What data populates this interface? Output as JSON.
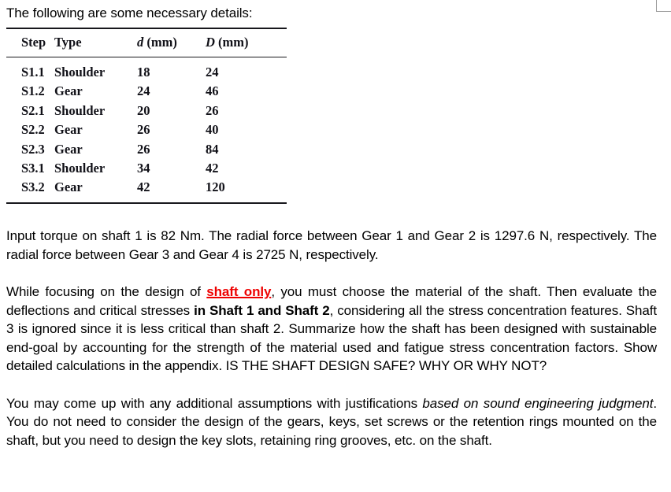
{
  "document": {
    "intro_line": "The following are some necessary details:",
    "corner_mark": "crop-mark"
  },
  "spec_table": {
    "columns": [
      {
        "key": "step",
        "label": "Step",
        "italic_symbol": "",
        "unit": ""
      },
      {
        "key": "type",
        "label": "Type",
        "italic_symbol": "",
        "unit": ""
      },
      {
        "key": "d",
        "label": "d (mm)",
        "italic_symbol": "d",
        "unit": "(mm)"
      },
      {
        "key": "D",
        "label": "D (mm)",
        "italic_symbol": "D",
        "unit": "(mm)"
      }
    ],
    "rows": [
      {
        "step": "S1.1",
        "type": "Shoulder",
        "d": "18",
        "D": "24"
      },
      {
        "step": "S1.2",
        "type": "Gear",
        "d": "24",
        "D": "46"
      },
      {
        "step": "S2.1",
        "type": "Shoulder",
        "d": "20",
        "D": "26"
      },
      {
        "step": "S2.2",
        "type": "Gear",
        "d": "26",
        "D": "40"
      },
      {
        "step": "S2.3",
        "type": "Gear",
        "d": "26",
        "D": "84"
      },
      {
        "step": "S3.1",
        "type": "Shoulder",
        "d": "34",
        "D": "42"
      },
      {
        "step": "S3.2",
        "type": "Gear",
        "d": "42",
        "D": "120"
      }
    ]
  },
  "paragraphs": {
    "torque": {
      "text": "Input torque on shaft 1 is 82 Nm. The radial force between Gear 1 and Gear 2 is 1297.6 N, respectively. The radial force between Gear 3 and Gear 4 is  2725 N, respectively."
    },
    "design": {
      "seg_1": "While focusing on the design of ",
      "seg_highlight_red": "shaft only",
      "seg_2": ", you must choose the material of the shaft. Then evaluate the deflections and critical stresses ",
      "seg_bold": "in Shaft 1 and Shaft 2",
      "seg_3": ", considering all the stress concentration features. Shaft 3 is ignored since it is less critical than shaft 2. Summarize how the shaft has been designed with sustainable end-goal by accounting for the strength of the material used and fatigue stress concentration factors. Show detailed calculations in the appendix. IS THE SHAFT DESIGN SAFE? WHY OR WHY NOT?"
    },
    "assumptions": {
      "seg_1": "You may come up with any additional assumptions with justifications ",
      "seg_italic": "based on sound engineering judgment",
      "seg_2": ". You do not need to consider the design of the gears, keys, set screws or the retention rings mounted on the shaft, but you need to design the key slots, retaining ring grooves, etc. on the shaft."
    }
  },
  "colors": {
    "highlight_red": "#ee0000",
    "text_black": "#000000",
    "rule_black": "#17171c",
    "corner_mark_gray": "#9a9a9a"
  }
}
